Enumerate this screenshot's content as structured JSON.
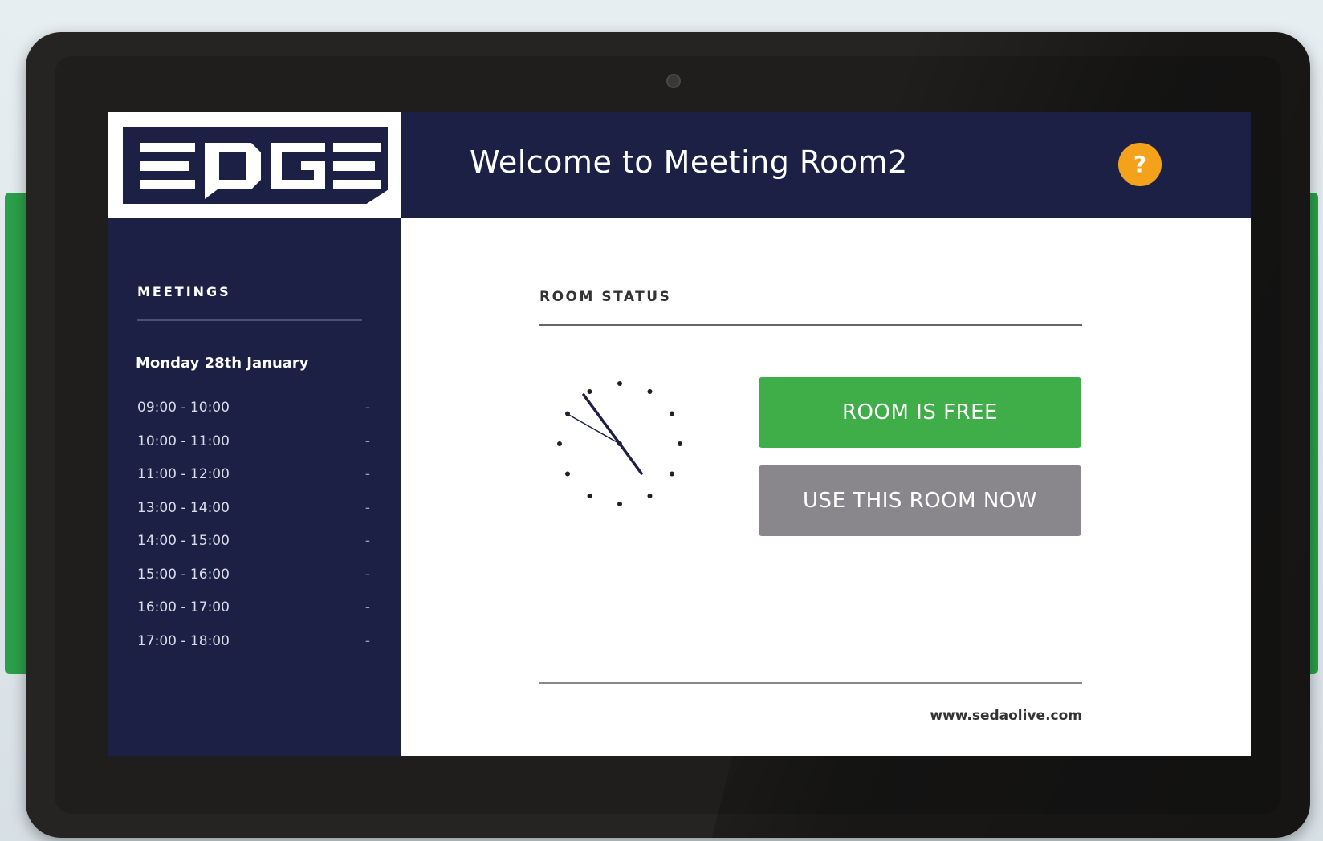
{
  "header": {
    "logo_text": "EDGE",
    "welcome": "Welcome to Meeting Room2",
    "help_label": "?"
  },
  "sidebar": {
    "title": "MEETINGS",
    "date": "Monday 28th January",
    "slots": [
      {
        "time": "09:00 - 10:00",
        "status": "-"
      },
      {
        "time": "10:00 - 11:00",
        "status": "-"
      },
      {
        "time": "11:00 - 12:00",
        "status": "-"
      },
      {
        "time": "13:00 - 14:00",
        "status": "-"
      },
      {
        "time": "14:00 - 15:00",
        "status": "-"
      },
      {
        "time": "15:00 - 16:00",
        "status": "-"
      },
      {
        "time": "16:00 - 17:00",
        "status": "-"
      },
      {
        "time": "17:00 - 18:00",
        "status": "-"
      }
    ]
  },
  "main": {
    "title": "ROOM STATUS",
    "free_button": "ROOM IS FREE",
    "use_button": "USE THIS ROOM NOW",
    "footer_url": "www.sedaolive.com"
  },
  "colors": {
    "header_bg": "#1c2045",
    "free_green": "#3fae49",
    "use_gray": "#8a878c",
    "help_orange": "#f4a21b"
  },
  "icons": {
    "help": "question-icon",
    "clock": "analog-clock-icon",
    "camera": "camera-icon"
  }
}
